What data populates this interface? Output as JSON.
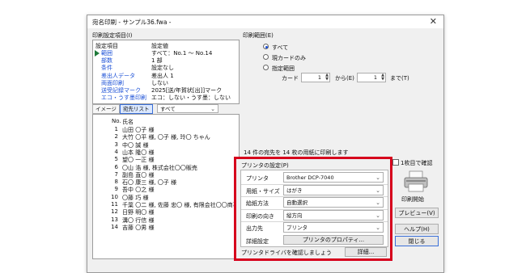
{
  "window": {
    "title": "宛名印刷 - サンプル36.fwa -",
    "close_glyph": "✕"
  },
  "settings_group": {
    "label": "印刷設定項目(I)",
    "col_item": "設定項目",
    "col_value": "設定値",
    "rows": [
      {
        "item": "範囲",
        "value": "すべて：No.1 〜 No.14"
      },
      {
        "item": "部数",
        "value": "1 部"
      },
      {
        "item": "条件",
        "value": "設定なし"
      },
      {
        "item": "差出人データ",
        "value": "差出人 1"
      },
      {
        "item": "両面印刷",
        "value": "しない"
      },
      {
        "item": "送受記録マーク",
        "value": "2025[送/年賀状[出]]マーク"
      },
      {
        "item": "エコ・うす墨印刷",
        "value": "エコ：しない・うす墨：しない"
      }
    ]
  },
  "list_tabs": {
    "image": "イメージ",
    "list": "宛先リスト",
    "filter": "すべて"
  },
  "address_list": {
    "col_no": "No.",
    "col_name": "氏名",
    "rows": [
      {
        "no": "1",
        "name": "山田 〇子 様"
      },
      {
        "no": "2",
        "name": "大竹 〇平 様, 〇子 様, 玲〇 ちゃん"
      },
      {
        "no": "3",
        "name": "中〇 誠 様"
      },
      {
        "no": "4",
        "name": "山本 隆〇 様"
      },
      {
        "no": "5",
        "name": "望〇 一正 様"
      },
      {
        "no": "6",
        "name": "〇山 浩 様, 株式会社〇〇販売"
      },
      {
        "no": "7",
        "name": "副島 直〇 様"
      },
      {
        "no": "8",
        "name": "石〇 康三 様, 〇子 様"
      },
      {
        "no": "9",
        "name": "吾中 〇之 様"
      },
      {
        "no": "10",
        "name": "〇藤 巧 様"
      },
      {
        "no": "11",
        "name": "千葉 〇二 様, 佐藤 忠〇 様, 有限会社〇〇商事"
      },
      {
        "no": "12",
        "name": "日野 明〇 様"
      },
      {
        "no": "13",
        "name": "溝〇 行信 様"
      },
      {
        "no": "14",
        "name": "吉藤 〇男 様"
      }
    ]
  },
  "print_range": {
    "label": "印刷範囲(E)",
    "opt_all": "すべて",
    "opt_current": "現カードのみ",
    "opt_specified": "指定範囲",
    "card_label": "カード",
    "from_value": "1",
    "from_label": "から(E)",
    "to_value": "1",
    "to_label": "まで(T)"
  },
  "summary": "14 件の宛先を 14 枚の用紙に印刷します",
  "printer_group": {
    "label": "プリンタの設定(P)",
    "rows": [
      {
        "label": "プリンタ",
        "value": "Brother DCP-7040"
      },
      {
        "label": "用紙・サイズ",
        "value": "はがき"
      },
      {
        "label": "給紙方法",
        "value": "自動選択"
      },
      {
        "label": "印刷の向き",
        "value": "縦方向"
      },
      {
        "label": "出力先",
        "value": "プリンタ"
      }
    ],
    "detail_label": "詳細設定",
    "property_button": "プリンタのプロパティ...",
    "notice": "プリンタドライバを確認しましょう",
    "notice_button": "詳細..."
  },
  "right_panel": {
    "single_check_label": "1枚目で確認",
    "start_button": "印刷開始",
    "preview_button": "プレビュー(V)",
    "help_button": "ヘルプ(H)",
    "close_button": "閉じる"
  },
  "colors": {
    "accent": "#1a4fd6",
    "highlight": "#d6001c",
    "marker": "#1f7a3a"
  }
}
